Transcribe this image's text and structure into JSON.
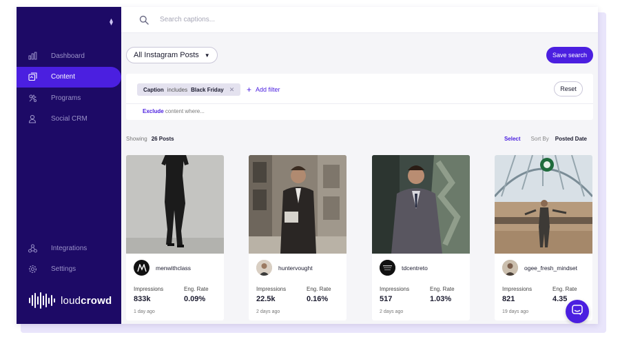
{
  "sidebar": {
    "nav": [
      {
        "label": "Dashboard",
        "icon": "bar-chart-icon",
        "active": false
      },
      {
        "label": "Content",
        "icon": "content-icon",
        "active": true
      },
      {
        "label": "Programs",
        "icon": "programs-icon",
        "active": false
      },
      {
        "label": "Social CRM",
        "icon": "person-icon",
        "active": false
      }
    ],
    "bottom_nav": [
      {
        "label": "Integrations",
        "icon": "integrations-icon"
      },
      {
        "label": "Settings",
        "icon": "gear-icon"
      }
    ],
    "logo": {
      "prefix": "loud",
      "suffix": "crowd"
    }
  },
  "search": {
    "placeholder": "Search captions..."
  },
  "toolbar": {
    "source_dropdown": "All Instagram Posts",
    "save_search_label": "Save search"
  },
  "filters": {
    "chip": {
      "field": "Caption",
      "operator": "includes",
      "value": "Black Friday"
    },
    "add_filter_label": "Add filter",
    "reset_label": "Reset",
    "exclude_keyword": "Exclude",
    "exclude_rest": "content where..."
  },
  "results": {
    "showing_label": "Showing",
    "count": "26 Posts",
    "select_label": "Select",
    "sort_label": "Sort By",
    "sort_value": "Posted Date"
  },
  "posts": [
    {
      "username": "menwithclass",
      "impressions_label": "Impressions",
      "impressions": "833k",
      "rate_label": "Eng. Rate",
      "rate": "0.09%",
      "posted": "1 day ago"
    },
    {
      "username": "huntervought",
      "impressions_label": "Impressions",
      "impressions": "22.5k",
      "rate_label": "Eng. Rate",
      "rate": "0.16%",
      "posted": "2 days ago"
    },
    {
      "username": "tdcentreto",
      "impressions_label": "Impressions",
      "impressions": "517",
      "rate_label": "Eng. Rate",
      "rate": "1.03%",
      "posted": "2 days ago"
    },
    {
      "username": "ogee_fresh_mindset",
      "impressions_label": "Impressions",
      "impressions": "821",
      "rate_label": "Eng. Rate",
      "rate": "4.35",
      "posted": "19 days ago"
    }
  ],
  "colors": {
    "sidebar": "#1d0a66",
    "accent": "#4b1fe0",
    "background": "#f5f5f8"
  }
}
